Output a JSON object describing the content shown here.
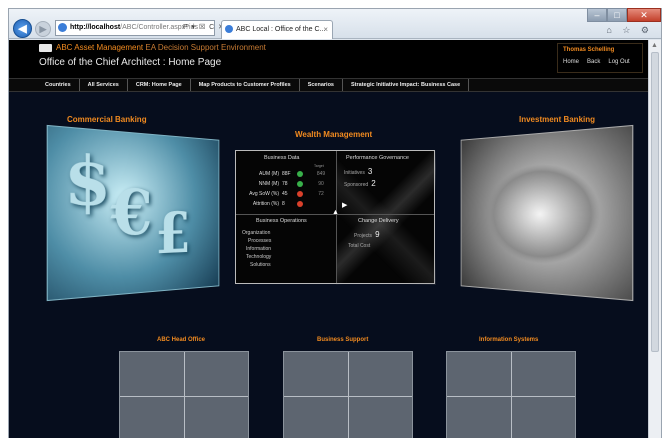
{
  "browser": {
    "address_host": "http://localhost",
    "address_path": "/ABC/Controller.aspx?ids",
    "address_tools": "P ▾ ☒ C ✕",
    "tab_title": "ABC Local : Office of the C...",
    "tab_close": "×",
    "back": "◀",
    "forward": "▶",
    "minimize": "–",
    "maximize": "□",
    "close": "✕",
    "right_icons": "⌂ ☆ ⚙"
  },
  "header": {
    "company": "ABC Asset Management",
    "subtitle": "EA Decision Support Environment",
    "page_title": "Office of the Chief Architect : Home Page",
    "user_name": "Thomas Schelling",
    "user_links": [
      "Home",
      "Back",
      "Log Out"
    ]
  },
  "menu": [
    "Countries",
    "All Services",
    "CRM: Home Page",
    "Map Products to Customer Profiles",
    "Scenarios",
    "Strategic Initiative Impact: Business Case"
  ],
  "sections": {
    "commercial": "Commercial Banking",
    "wealth": "Wealth Management",
    "investment": "Investment Banking"
  },
  "commercial_glyphs": [
    "$",
    "€",
    "£"
  ],
  "center": {
    "business_data": {
      "title": "Business Data",
      "target_head": "Target",
      "rows": [
        {
          "label": "AUM (M)",
          "value": "88F",
          "status_color": "#38b04a",
          "target": "849"
        },
        {
          "label": "NNM (M)",
          "value": "78",
          "status_color": "#38b04a",
          "target": "90"
        },
        {
          "label": "Avg SoW (%)",
          "value": "45",
          "status_color": "#d9402b",
          "target": "72"
        },
        {
          "label": "Attrition (%)",
          "value": "8",
          "status_color": "#d9402b",
          "target": ""
        }
      ]
    },
    "performance": {
      "title": "Performance Governance",
      "rows": [
        {
          "label": "Initiatives",
          "value": "3"
        },
        {
          "label": "Sponsored",
          "value": "2"
        }
      ]
    },
    "operations": {
      "title": "Business Operations",
      "items": [
        "Organization",
        "Processes",
        "Information",
        "Technology",
        "Solutions"
      ]
    },
    "change": {
      "title": "Change Delivery",
      "rows": [
        {
          "label": "Projects",
          "value": "9"
        },
        {
          "label": "Total Cost",
          "value": ""
        }
      ]
    },
    "arrow_up": "▲",
    "arrow_right": "▶"
  },
  "bottom_sections": [
    "ABC Head Office",
    "Business Support",
    "Information Systems"
  ],
  "scroll_up": "▲"
}
